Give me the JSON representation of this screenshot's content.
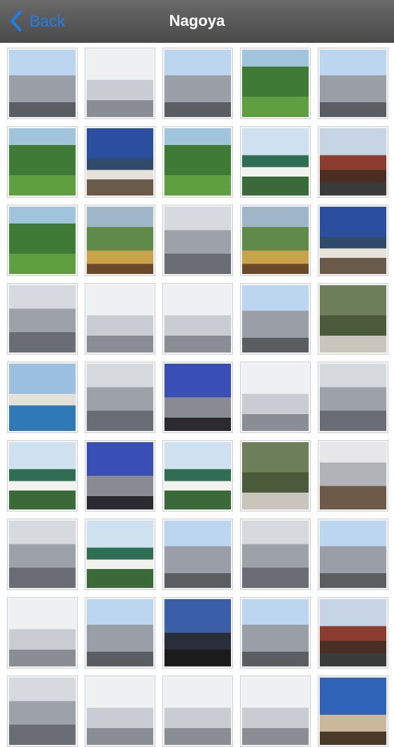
{
  "navbar": {
    "back_label": "Back",
    "title": "Nagoya",
    "back_icon": "chevron-left-icon",
    "accent_color": "#1d7fe6"
  },
  "gallery": {
    "tiles": [
      {
        "theme": "t-sky-city"
      },
      {
        "theme": "t-pale"
      },
      {
        "theme": "t-sky-city"
      },
      {
        "theme": "t-green"
      },
      {
        "theme": "t-sky-city"
      },
      {
        "theme": "t-green"
      },
      {
        "theme": "t-castle-blue"
      },
      {
        "theme": "t-green"
      },
      {
        "theme": "t-castle"
      },
      {
        "theme": "t-temple"
      },
      {
        "theme": "t-green"
      },
      {
        "theme": "t-garden"
      },
      {
        "theme": "t-grey-city"
      },
      {
        "theme": "t-garden"
      },
      {
        "theme": "t-castle-blue"
      },
      {
        "theme": "t-grey-city"
      },
      {
        "theme": "t-pale"
      },
      {
        "theme": "t-pale"
      },
      {
        "theme": "t-sky-city"
      },
      {
        "theme": "t-shrine"
      },
      {
        "theme": "t-water"
      },
      {
        "theme": "t-grey-city"
      },
      {
        "theme": "t-tower"
      },
      {
        "theme": "t-pale"
      },
      {
        "theme": "t-grey-city"
      },
      {
        "theme": "t-castle"
      },
      {
        "theme": "t-tower"
      },
      {
        "theme": "t-castle"
      },
      {
        "theme": "t-shrine"
      },
      {
        "theme": "t-dome"
      },
      {
        "theme": "t-grey-city"
      },
      {
        "theme": "t-castle"
      },
      {
        "theme": "t-sky-city"
      },
      {
        "theme": "t-grey-city"
      },
      {
        "theme": "t-sky-city"
      },
      {
        "theme": "t-pale"
      },
      {
        "theme": "t-sky-city"
      },
      {
        "theme": "t-night"
      },
      {
        "theme": "t-sky-city"
      },
      {
        "theme": "t-temple"
      },
      {
        "theme": "t-grey-city"
      },
      {
        "theme": "t-pale"
      },
      {
        "theme": "t-pale"
      },
      {
        "theme": "t-pale"
      },
      {
        "theme": "t-blue-sky"
      }
    ]
  }
}
